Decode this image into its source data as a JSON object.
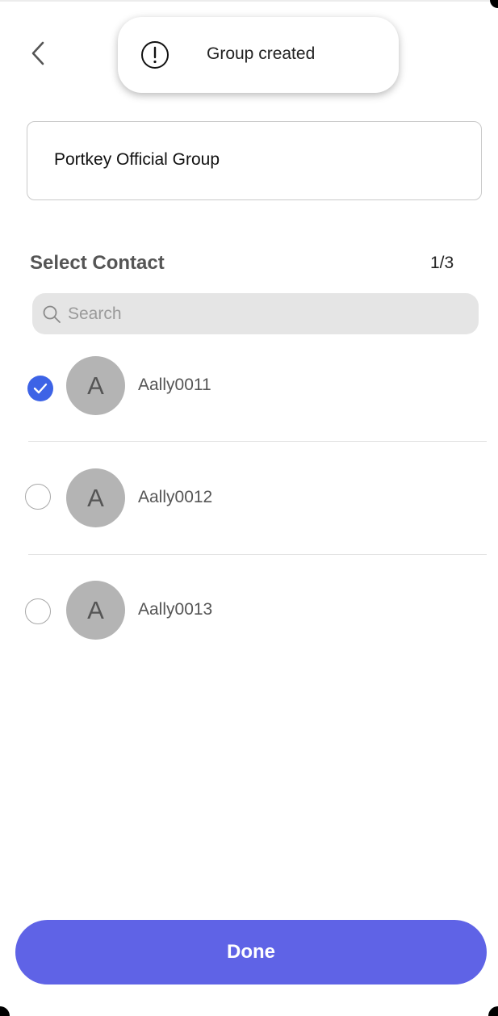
{
  "header": {
    "back_icon": "chevron-left-icon"
  },
  "toast": {
    "icon": "exclamation-circle-icon",
    "message": "Group created"
  },
  "group_name": {
    "value": "Portkey Official Group"
  },
  "select_contact": {
    "title": "Select Contact",
    "count": "1/3"
  },
  "search": {
    "icon": "search-icon",
    "placeholder": "Search",
    "value": ""
  },
  "contacts": [
    {
      "initial": "A",
      "name": "Aally0011",
      "selected": true
    },
    {
      "initial": "A",
      "name": "Aally0012",
      "selected": false
    },
    {
      "initial": "A",
      "name": "Aally0013",
      "selected": false
    }
  ],
  "footer": {
    "done_label": "Done"
  },
  "colors": {
    "accent": "#5f63e6",
    "checkbox_selected": "#3d63e6",
    "avatar_bg": "#b4b4b4"
  }
}
